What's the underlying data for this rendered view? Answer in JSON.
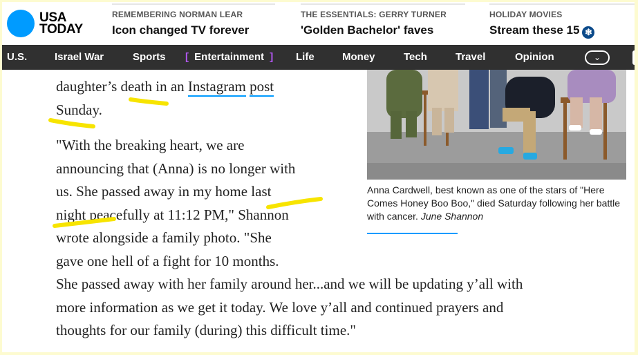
{
  "logo": {
    "line1": "USA",
    "line2": "TODAY"
  },
  "promos": [
    {
      "kicker": "REMEMBERING NORMAN LEAR",
      "title": "Icon changed TV forever"
    },
    {
      "kicker": "THE ESSENTIALS: GERRY TURNER",
      "title": "'Golden Bachelor' faves"
    },
    {
      "kicker": "HOLIDAY MOVIES",
      "title": "Stream these 15",
      "icon": "snowflake-icon"
    }
  ],
  "nav": {
    "items": [
      "U.S.",
      "Israel War",
      "Sports",
      "Entertainment",
      "Life",
      "Money",
      "Tech",
      "Travel",
      "Opinion"
    ],
    "active_index": 3,
    "bracket_left": "[",
    "bracket_right": "]",
    "more_icon": "chevron-down-icon",
    "more_glyph": "⌄"
  },
  "article": {
    "line1": {
      "pre": "daughter’s death in an ",
      "link1": "Instagram",
      "sp": " ",
      "link2": "post"
    },
    "line2": "Sunday.",
    "quote_lines": [
      "\"With the breaking heart, we are",
      "announcing that (Anna) is no longer with",
      "us. She passed away in my home last",
      "night peacefully at 11:12 PM,\" Shannon",
      "wrote alongside a family photo. \"She",
      "gave one hell of a fight for 10 months.",
      "She passed away with her family around her...and we will be updating y’all with",
      "more information as we get it today. We love y’all and continued prayers and",
      "thoughts for our family (during) this difficult time.\""
    ]
  },
  "photo": {
    "caption": "Anna Cardwell, best known as one of the stars of \"Here Comes Honey Boo Boo,\" died Saturday following her battle with cancer.",
    "credit": "June Shannon"
  },
  "colors": {
    "brand_blue": "#009bff",
    "nav_bg": "#303030",
    "bracket": "#b257f2",
    "highlight": "#f7e400",
    "page_bg": "#fdfbd0"
  }
}
